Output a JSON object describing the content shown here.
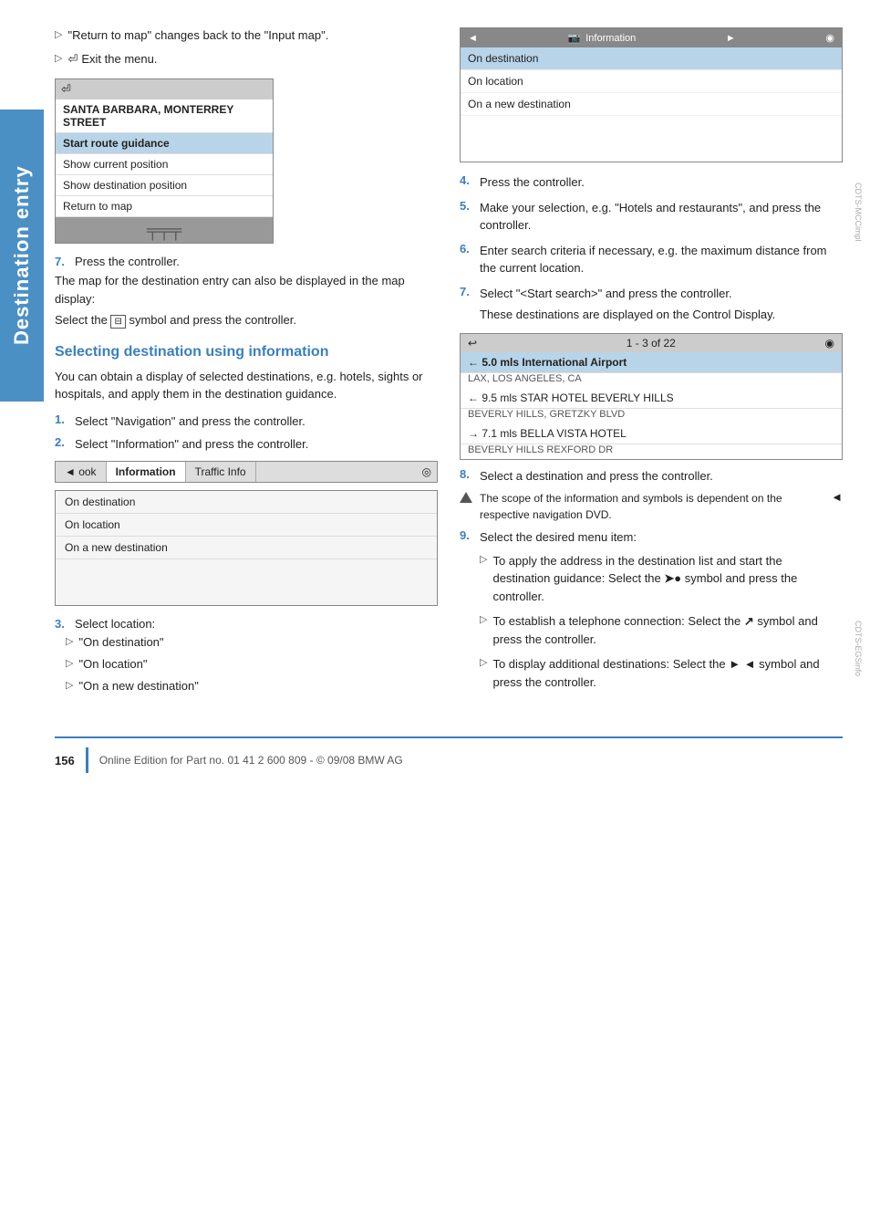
{
  "sidebar": {
    "label": "Destination entry"
  },
  "page": {
    "number": "156",
    "footer_text": "Online Edition for Part no. 01 41 2 600 809 - © 09/08 BMW AG"
  },
  "left_col": {
    "bullet1": "\"Return to map\" changes back to the \"Input map\".",
    "bullet2": "Exit the menu.",
    "step7_label": "7.",
    "step7_text": "Press the controller.",
    "step7_desc1": "The map for the destination entry can also be displayed in the map display:",
    "step7_desc2": "Select the  symbol and press the controller.",
    "section_heading": "Selecting destination using information",
    "section_intro": "You can obtain a display of selected destinations, e.g. hotels, sights or hospitals, and apply them in the destination guidance.",
    "step1_label": "1.",
    "step1_text": "Select \"Navigation\" and press the controller.",
    "step2_label": "2.",
    "step2_text": "Select \"Information\" and press the controller.",
    "step3_label": "3.",
    "step3_text": "Select location:",
    "bullet_on_dest": "\"On destination\"",
    "bullet_on_loc": "\"On location\"",
    "bullet_on_new": "\"On a new destination\""
  },
  "right_col": {
    "step4_label": "4.",
    "step4_text": "Press the controller.",
    "step5_label": "5.",
    "step5_text": "Make your selection, e.g. \"Hotels and restaurants\", and press the controller.",
    "step6_label": "6.",
    "step6_text": "Enter search criteria if necessary, e.g. the maximum distance from the current location.",
    "step7_label": "7.",
    "step7_text": "Select \"<Start search>\" and press the controller.",
    "step7_desc": "These destinations are displayed on the Control Display.",
    "step8_label": "8.",
    "step8_text": "Select a destination and press the controller.",
    "note_text": "The scope of the information and symbols is dependent on the respective navigation DVD.",
    "step9_label": "9.",
    "step9_text": "Select the desired menu item:",
    "sub1_text": "To apply the address in the destination list and start the destination guidance: Select the  symbol and press the controller.",
    "sub2_text": "To establish a telephone connection: Select the  symbol and press the controller.",
    "sub3_text": "To display additional destinations: Select the   symbol and press the controller."
  },
  "screen_top_left": {
    "row1": "SANTA BARBARA, MONTERREY STREET",
    "row2": "Start route guidance",
    "row3": "Show current position",
    "row4": "Show destination position",
    "row5": "Return to map"
  },
  "screen_top_right": {
    "header": "Information",
    "row1": "On destination",
    "row2": "On location",
    "row3": "On a new destination"
  },
  "nav_bar": {
    "back": "◄ ook",
    "active": "Information",
    "next": "Traffic Info",
    "icon": "◎"
  },
  "info_menu": {
    "row1": "On destination",
    "row2": "On location",
    "row3": "On a new destination"
  },
  "result_screen": {
    "header_back": "↩",
    "header_count": "1 - 3 of 22",
    "header_icon": "◉",
    "row1_arrow": "← 5.0 mls",
    "row1_name": "International Airport",
    "row1_sub": "LAX, LOS ANGELES, CA",
    "row2_arrow": "← 9.5 mls",
    "row2_name": "STAR HOTEL BEVERLY HILLS",
    "row2_sub": "BEVERLY HILLS, GRETZKY BLVD",
    "row3_arrow": "→ 7.1 mls",
    "row3_name": "BELLA VISTA HOTEL",
    "row3_sub": "BEVERLY HILLS REXFORD DR"
  }
}
